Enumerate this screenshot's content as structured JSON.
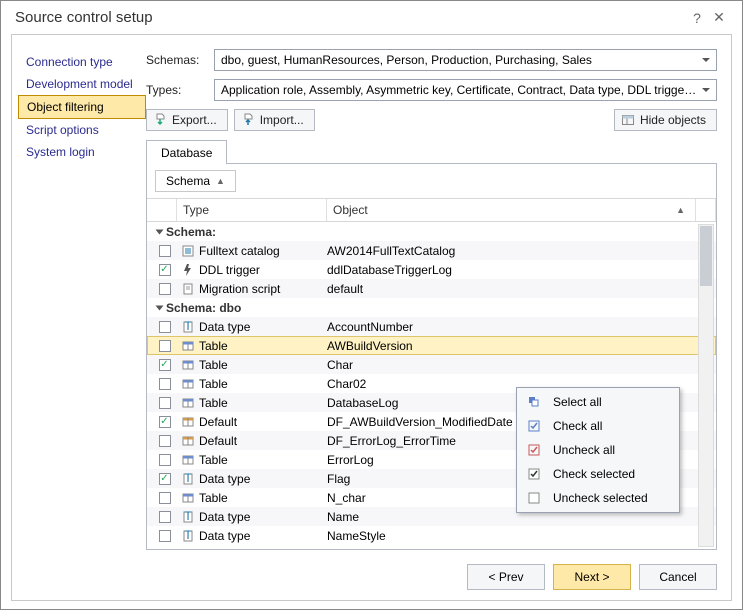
{
  "title": "Source control setup",
  "sidebar": {
    "items": [
      {
        "label": "Connection type"
      },
      {
        "label": "Development model"
      },
      {
        "label": "Object filtering"
      },
      {
        "label": "Script options"
      },
      {
        "label": "System login"
      }
    ],
    "selected_index": 2
  },
  "form": {
    "schemas_label": "Schemas:",
    "schemas_value": "dbo, guest, HumanResources, Person, Production, Purchasing, Sales",
    "types_label": "Types:",
    "types_value": "Application role, Assembly, Asymmetric key, Certificate, Contract, Data type, DDL trigger, Default, Ev..."
  },
  "toolbar": {
    "export_label": "Export...",
    "import_label": "Import...",
    "hide_label": "Hide objects"
  },
  "tab_label": "Database",
  "group_pill": "Schema",
  "columns": {
    "type": "Type",
    "object": "Object"
  },
  "schema_groups": [
    {
      "header": "Schema:"
    },
    {
      "header": "Schema: dbo"
    }
  ],
  "rows_group0": [
    {
      "checked": false,
      "type": "Fulltext catalog",
      "object": "AW2014FullTextCatalog",
      "icon": "catalog"
    },
    {
      "checked": true,
      "type": "DDL trigger",
      "object": "ddlDatabaseTriggerLog",
      "icon": "trigger"
    },
    {
      "checked": false,
      "type": "Migration script",
      "object": "default",
      "icon": "script"
    }
  ],
  "rows_group1": [
    {
      "checked": false,
      "type": "Data type",
      "object": "AccountNumber",
      "icon": "datatype"
    },
    {
      "checked": false,
      "type": "Table",
      "object": "AWBuildVersion",
      "icon": "table",
      "selected": true
    },
    {
      "checked": true,
      "type": "Table",
      "object": "Char",
      "icon": "table"
    },
    {
      "checked": false,
      "type": "Table",
      "object": "Char02",
      "icon": "table"
    },
    {
      "checked": false,
      "type": "Table",
      "object": "DatabaseLog",
      "icon": "table"
    },
    {
      "checked": true,
      "type": "Default",
      "object": "DF_AWBuildVersion_ModifiedDate",
      "icon": "default"
    },
    {
      "checked": false,
      "type": "Default",
      "object": "DF_ErrorLog_ErrorTime",
      "icon": "default"
    },
    {
      "checked": false,
      "type": "Table",
      "object": "ErrorLog",
      "icon": "table"
    },
    {
      "checked": true,
      "type": "Data type",
      "object": "Flag",
      "icon": "datatype"
    },
    {
      "checked": false,
      "type": "Table",
      "object": "N_char",
      "icon": "table"
    },
    {
      "checked": false,
      "type": "Data type",
      "object": "Name",
      "icon": "datatype"
    },
    {
      "checked": false,
      "type": "Data type",
      "object": "NameStyle",
      "icon": "datatype"
    }
  ],
  "context_menu": [
    {
      "label": "Select all",
      "icon": "select-all"
    },
    {
      "label": "Check all",
      "icon": "check-all"
    },
    {
      "label": "Uncheck all",
      "icon": "uncheck-all"
    },
    {
      "label": "Check selected",
      "icon": "check-sel"
    },
    {
      "label": "Uncheck selected",
      "icon": "uncheck-sel"
    }
  ],
  "footer": {
    "prev": "< Prev",
    "next": "Next >",
    "cancel": "Cancel"
  }
}
